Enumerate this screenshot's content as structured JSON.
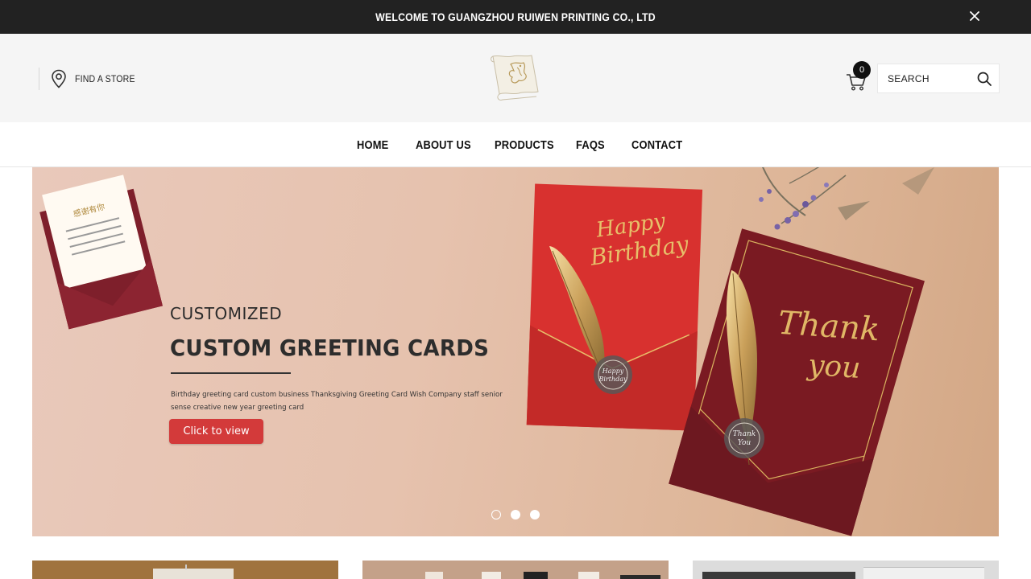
{
  "announcement": {
    "text": "WELCOME TO GUANGZHOU RUIWEN PRINTING CO., LTD",
    "close_icon": "close-icon"
  },
  "header": {
    "store_link_label": "FIND A STORE",
    "store_icon": "location-pin-icon",
    "logo_icon": "scroll-logo-icon",
    "cart_icon": "shopping-cart-icon",
    "cart_count": "0",
    "search_placeholder": "SEARCH",
    "search_icon": "search-icon"
  },
  "nav": {
    "items": [
      {
        "label": "HOME"
      },
      {
        "label": "ABOUT US"
      },
      {
        "label": "PRODUCTS"
      },
      {
        "label": "FAQS"
      },
      {
        "label": "CONTACT"
      }
    ]
  },
  "hero": {
    "kicker": "CUSTOMIZED",
    "title": "CUSTOM GREETING CARDS",
    "description": "Birthday greeting card custom business Thanksgiving Greeting Card Wish Company staff senior sense creative new year greeting card",
    "cta_label": "Click to view",
    "card_text_birthday": "Happy Birthday",
    "card_text_thanks": "Thank you",
    "seal_text_birthday": "Happy Birthday",
    "seal_text_thanks": "Thank you",
    "slides_total": 3,
    "active_slide": 2
  },
  "colors": {
    "topbar": "#222222",
    "header_bg": "#f5f5f5",
    "cta": "#d33a3a",
    "card_red": "#d8312f",
    "card_burgundy": "#7a1a22",
    "gold": "#e7c06a"
  }
}
